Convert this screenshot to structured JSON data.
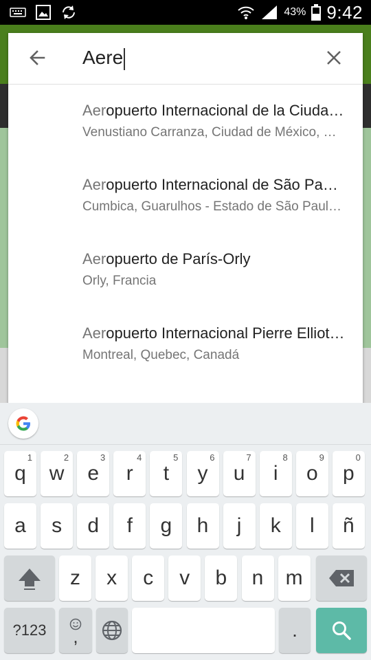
{
  "status_bar": {
    "time": "9:42",
    "battery_percent": "43%",
    "icons": [
      "keyboard-icon",
      "image-icon",
      "sync-icon",
      "wifi-icon",
      "signal-icon",
      "battery-icon"
    ]
  },
  "search": {
    "query": "Aere",
    "back_icon": "arrow-left-icon",
    "clear_icon": "close-icon"
  },
  "results": [
    {
      "match": "Aer",
      "rest": "opuerto Internacional de la Ciudad de México",
      "subtitle": "Venustiano Carranza, Ciudad de México, México"
    },
    {
      "match": "Aer",
      "rest": "opuerto Internacional de São Paulo-Guarulhos",
      "subtitle": "Cumbica, Guarulhos - Estado de São Paulo, Brasil"
    },
    {
      "match": "Aer",
      "rest": "opuerto de París-Orly",
      "subtitle": "Orly, Francia"
    },
    {
      "match": "Aer",
      "rest": "opuerto Internacional Pierre Elliott Trudeau",
      "subtitle": "Montreal, Quebec, Canadá"
    }
  ],
  "keyboard": {
    "row1": [
      {
        "label": "q",
        "hint": "1"
      },
      {
        "label": "w",
        "hint": "2"
      },
      {
        "label": "e",
        "hint": "3"
      },
      {
        "label": "r",
        "hint": "4"
      },
      {
        "label": "t",
        "hint": "5"
      },
      {
        "label": "y",
        "hint": "6"
      },
      {
        "label": "u",
        "hint": "7"
      },
      {
        "label": "i",
        "hint": "8"
      },
      {
        "label": "o",
        "hint": "9"
      },
      {
        "label": "p",
        "hint": "0"
      }
    ],
    "row2": [
      "a",
      "s",
      "d",
      "f",
      "g",
      "h",
      "j",
      "k",
      "l",
      "ñ"
    ],
    "row3": [
      "z",
      "x",
      "c",
      "v",
      "b",
      "n",
      "m"
    ],
    "symbols_label": "?123",
    "comma_label": ",",
    "period_label": ".",
    "accent_color": "#5dbaa7"
  }
}
